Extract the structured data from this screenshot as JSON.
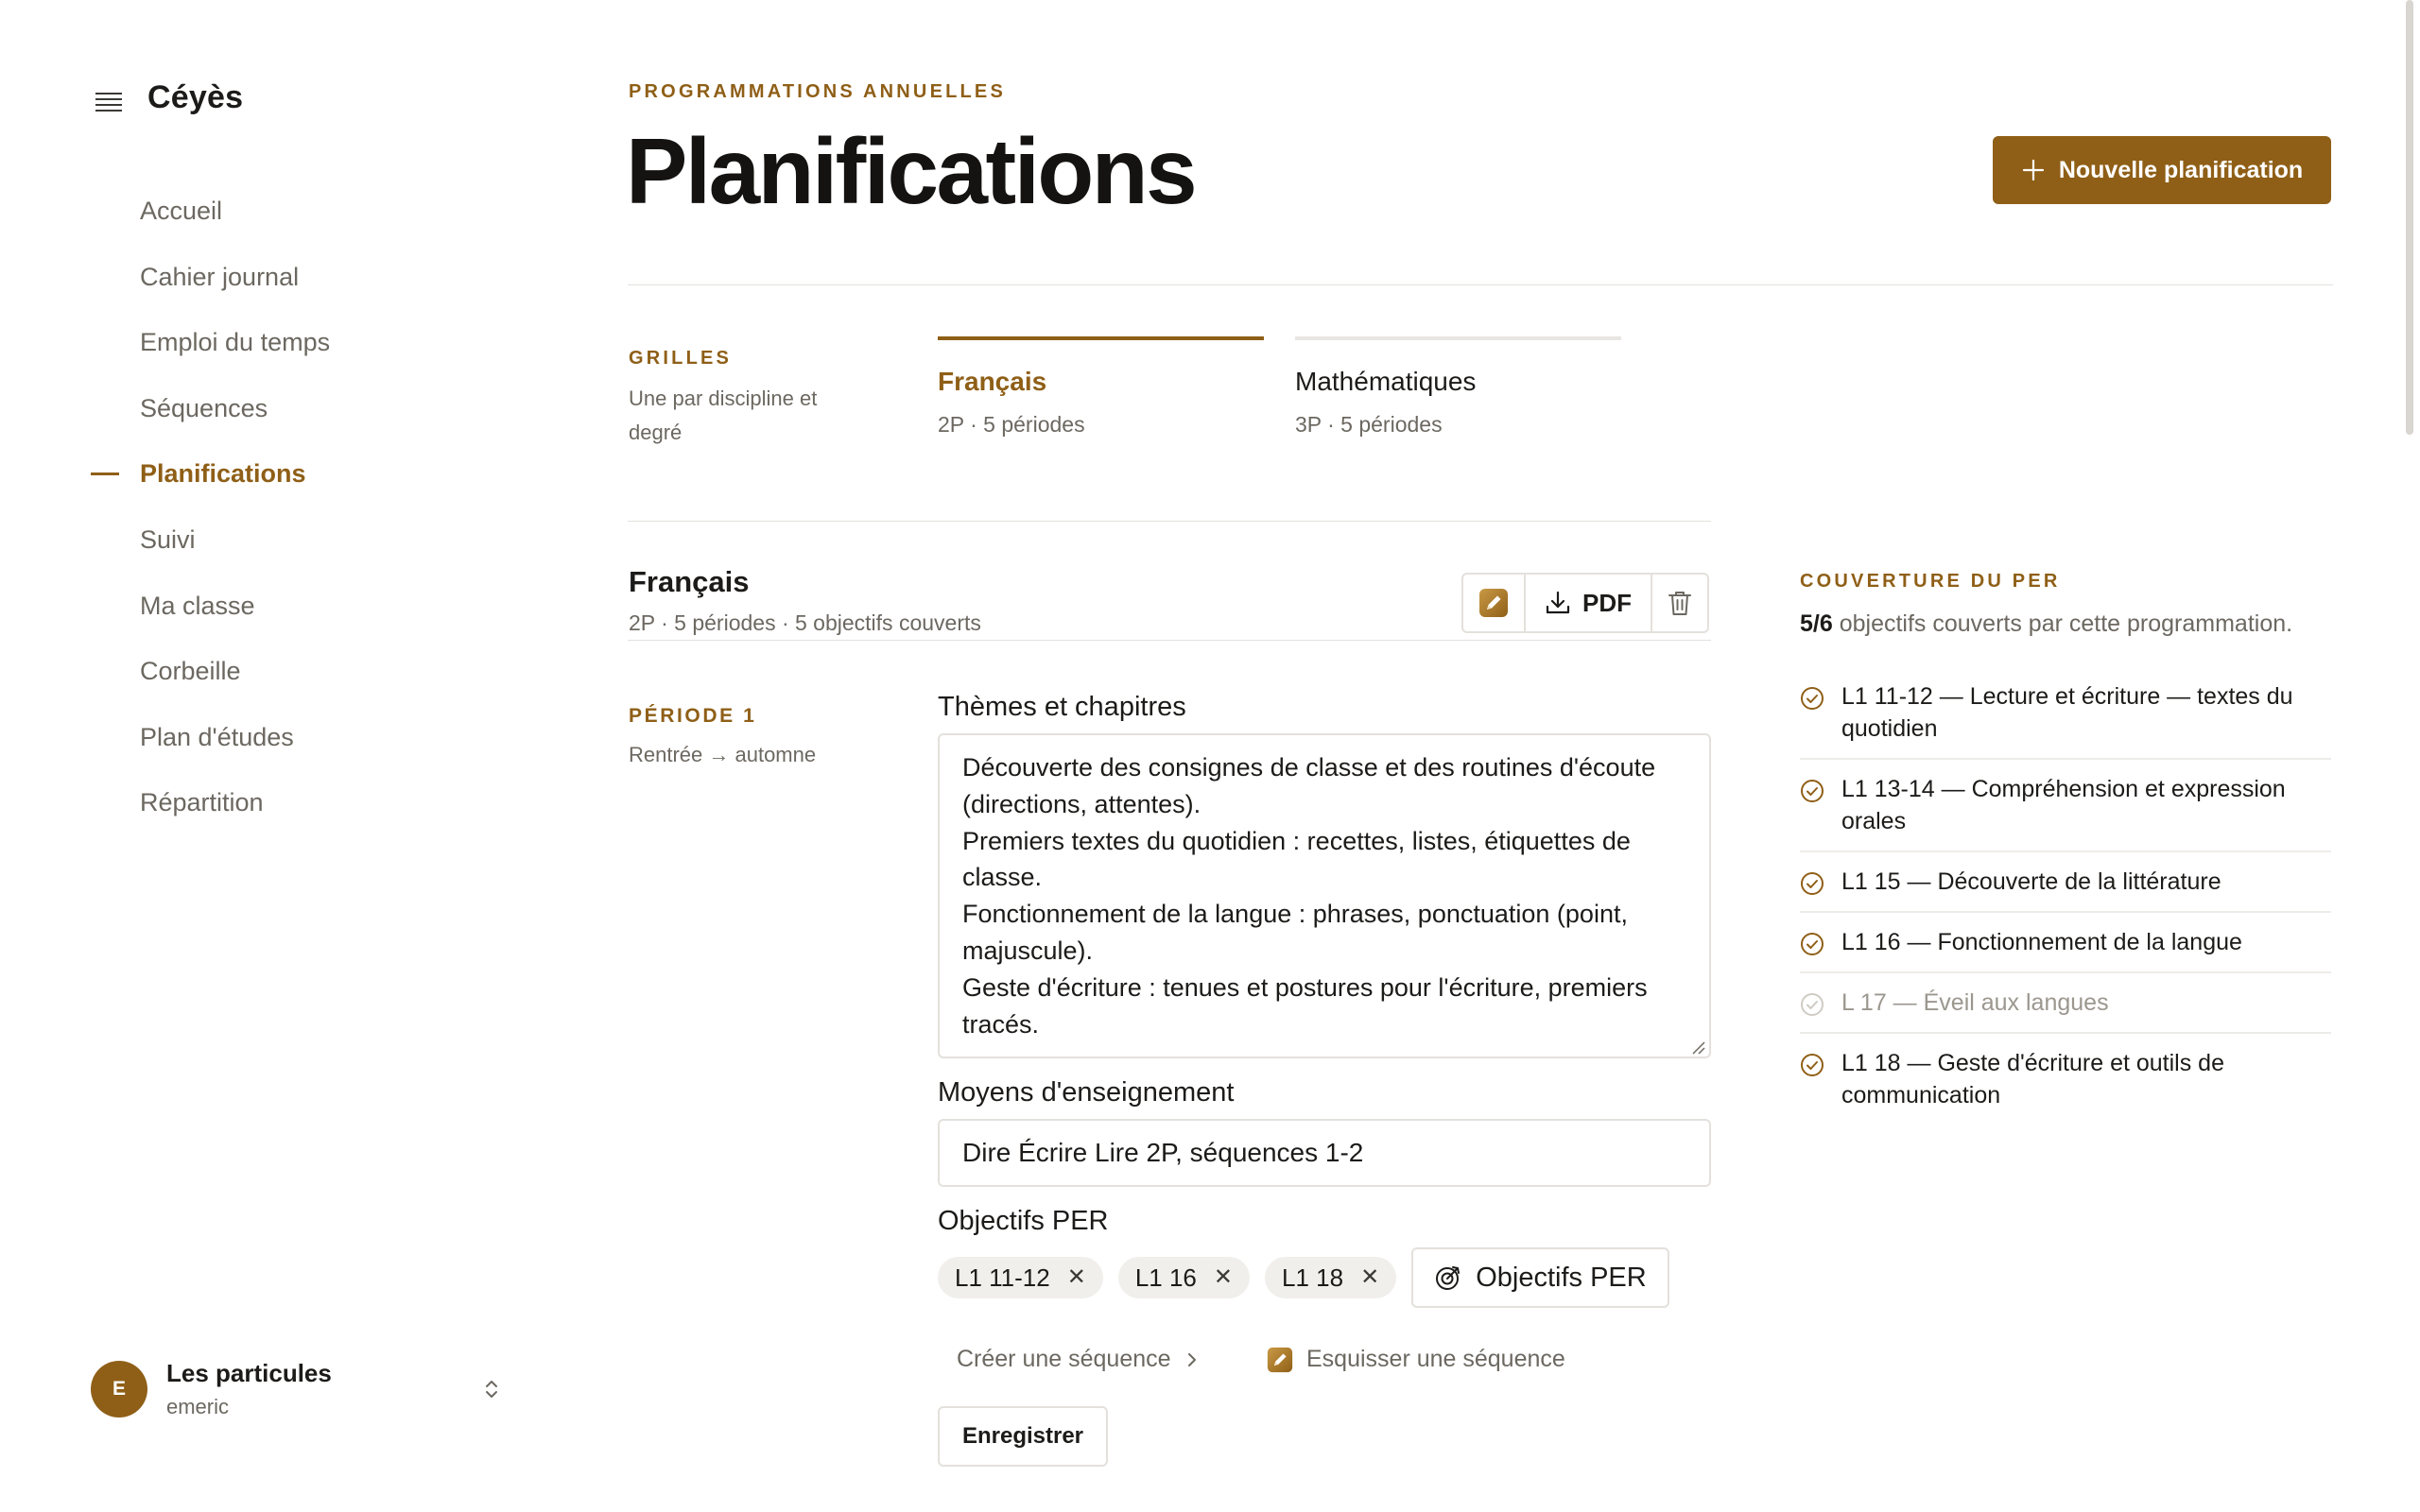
{
  "brand": {
    "name": "Céyès",
    "menu_icon": "menu-lines-icon"
  },
  "sidebar": {
    "items": [
      {
        "label": "Accueil",
        "active": false
      },
      {
        "label": "Cahier journal",
        "active": false
      },
      {
        "label": "Emploi du temps",
        "active": false
      },
      {
        "label": "Séquences",
        "active": false
      },
      {
        "label": "Planifications",
        "active": true
      },
      {
        "label": "Suivi",
        "active": false
      },
      {
        "label": "Ma classe",
        "active": false
      },
      {
        "label": "Corbeille",
        "active": false
      },
      {
        "label": "Plan d'études",
        "active": false
      },
      {
        "label": "Répartition",
        "active": false
      }
    ],
    "user": {
      "initial": "E",
      "name": "Les particules",
      "username": "emeric"
    }
  },
  "header": {
    "eyebrow": "PROGRAMMATIONS ANNUELLES",
    "title": "Planifications",
    "new_button_label": "Nouvelle planification"
  },
  "grids": {
    "label": "GRILLES",
    "description": "Une par discipline et degré",
    "tabs": [
      {
        "title": "Français",
        "subtitle": "2P · 5 périodes",
        "active": true
      },
      {
        "title": "Mathématiques",
        "subtitle": "3P · 5 périodes",
        "active": false
      }
    ]
  },
  "plan": {
    "title": "Français",
    "meta": "2P · 5 périodes · 5 objectifs couverts",
    "pdf_label": "PDF"
  },
  "period": {
    "label": "PÉRIODE 1",
    "range": "Rentrée → automne",
    "themes_label": "Thèmes et chapitres",
    "themes_text": "Découverte des consignes de classe et des routines d'écoute (directions, attentes).\nPremiers textes du quotidien : recettes, listes, étiquettes de classe.\nFonctionnement de la langue : phrases, ponctuation (point, majuscule).\nGeste d'écriture : tenues et postures pour l'écriture, premiers tracés.",
    "means_label": "Moyens d'enseignement",
    "means_value": "Dire Écrire Lire 2P, séquences 1-2",
    "objectives_label": "Objectifs PER",
    "objective_chips": [
      "L1 11-12",
      "L1 16",
      "L1 18"
    ],
    "objectives_button": "Objectifs PER",
    "create_sequence": "Créer une séquence",
    "sketch_sequence": "Esquisser une séquence",
    "save_label": "Enregistrer"
  },
  "coverage": {
    "title": "COUVERTURE DU PER",
    "count": "5/6",
    "summary_rest": " objectifs couverts par cette programmation.",
    "items": [
      {
        "code": "L1 11-12",
        "text": "L1 11-12 — Lecture et écriture — textes du quotidien",
        "covered": true
      },
      {
        "code": "L1 13-14",
        "text": "L1 13-14 — Compréhension et expression orales",
        "covered": true
      },
      {
        "code": "L1 15",
        "text": "L1 15 — Découverte de la littérature",
        "covered": true
      },
      {
        "code": "L1 16",
        "text": "L1 16 — Fonctionnement de la langue",
        "covered": true
      },
      {
        "code": "L 17",
        "text": "L 17 — Éveil aux langues",
        "covered": false
      },
      {
        "code": "L1 18",
        "text": "L1 18 — Geste d'écriture et outils de communication",
        "covered": true
      }
    ]
  },
  "colors": {
    "accent": "#8f5f17",
    "text": "#1c1b19",
    "muted": "#6c6861",
    "border": "#e4e1dc"
  }
}
